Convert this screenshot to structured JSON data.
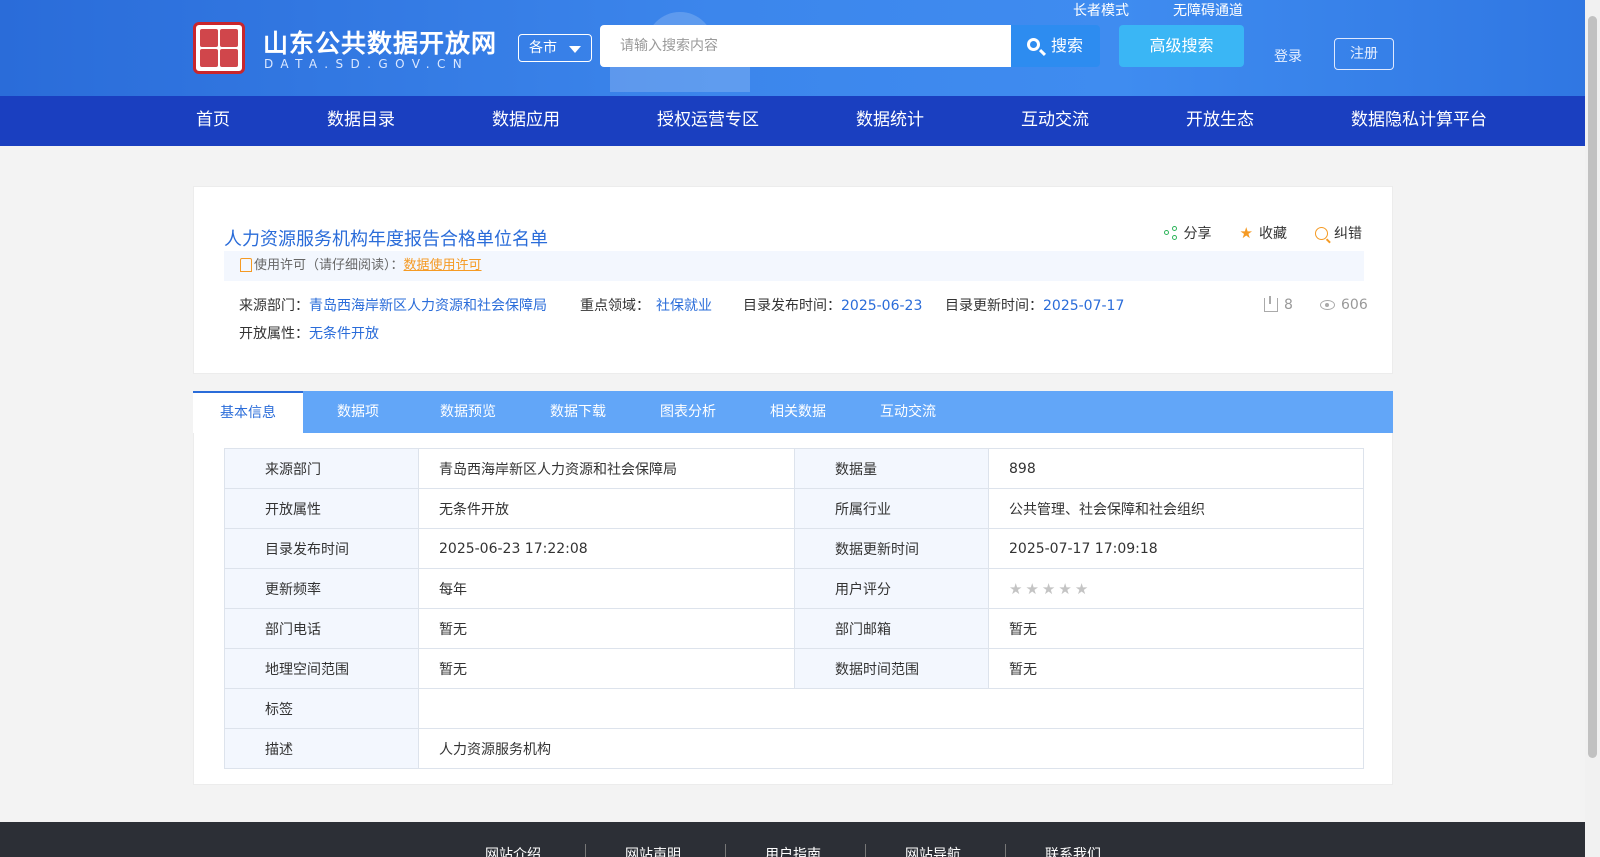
{
  "header": {
    "site_title": "山东公共数据开放网",
    "site_subtitle": "DATA.SD.GOV.CN",
    "elder_mode": "长者模式",
    "accessibility": "无障碍通道",
    "city_select": "各市",
    "search_placeholder": "请输入搜索内容",
    "search_label": "搜索",
    "advanced_search_label": "高级搜索",
    "login_label": "登录",
    "register_label": "注册"
  },
  "nav": {
    "items": [
      "首页",
      "数据目录",
      "数据应用",
      "授权运营专区",
      "数据统计",
      "互动交流",
      "开放生态",
      "数据隐私计算平台"
    ]
  },
  "dataset": {
    "title": "人力资源服务机构年度报告合格单位名单",
    "actions": {
      "share": "分享",
      "favorite": "收藏",
      "report": "纠错"
    },
    "license_prefix": "使用许可（请仔细阅读）：",
    "license_link": "数据使用许可",
    "source_label": "来源部门：",
    "source_value": "青岛西海岸新区人力资源和社会保障局",
    "domain_label": "重点领域：",
    "domain_value": "社保就业",
    "publish_label": "目录发布时间：",
    "publish_value": "2025-06-23",
    "update_label": "目录更新时间：",
    "update_value": "2025-07-17",
    "open_label": "开放属性：",
    "open_value": "无条件开放",
    "downloads": "8",
    "views": "606"
  },
  "tabs": [
    "基本信息",
    "数据项",
    "数据预览",
    "数据下载",
    "图表分析",
    "相关数据",
    "互动交流"
  ],
  "info": {
    "rows": [
      {
        "l1": "来源部门",
        "v1": "青岛西海岸新区人力资源和社会保障局",
        "l2": "数据量",
        "v2": "898"
      },
      {
        "l1": "开放属性",
        "v1": "无条件开放",
        "l2": "所属行业",
        "v2": "公共管理、社会保障和社会组织"
      },
      {
        "l1": "目录发布时间",
        "v1": "2025-06-23 17:22:08",
        "l2": "数据更新时间",
        "v2": "2025-07-17 17:09:18"
      },
      {
        "l1": "更新频率",
        "v1": "每年",
        "l2": "用户评分",
        "v2": ""
      },
      {
        "l1": "部门电话",
        "v1": "暂无",
        "l2": "部门邮箱",
        "v2": "暂无"
      },
      {
        "l1": "地理空间范围",
        "v1": "暂无",
        "l2": "数据时间范围",
        "v2": "暂无"
      }
    ],
    "tags_label": "标签",
    "tags_value": "",
    "desc_label": "描述",
    "desc_value": "人力资源服务机构",
    "rating": 0
  },
  "footer": {
    "links": [
      "网站介绍",
      "网站声明",
      "用户指南",
      "网站导航",
      "联系我们"
    ]
  },
  "colors": {
    "header_blue": "#3c86ec",
    "nav_blue": "#1a3fc0",
    "tab_blue": "#62a6f8",
    "link_blue": "#2a6cd9",
    "accent_orange": "#f59a23"
  }
}
